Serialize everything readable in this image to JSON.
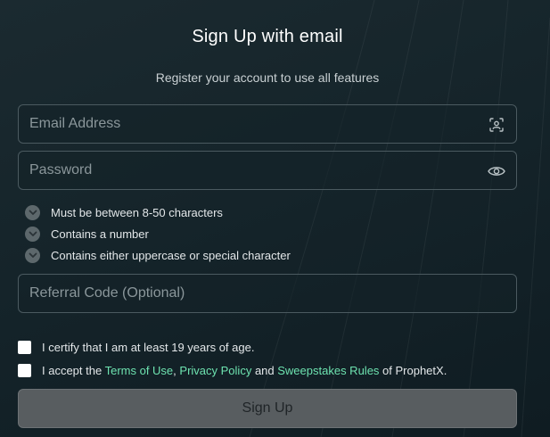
{
  "header": {
    "title": "Sign Up with email",
    "subtitle": "Register your account to use all features"
  },
  "form": {
    "email": {
      "placeholder": "Email Address",
      "value": "",
      "icon": "contact-card-icon"
    },
    "password": {
      "placeholder": "Password",
      "value": "",
      "icon": "eye-icon"
    },
    "referral": {
      "placeholder": "Referral Code (Optional)",
      "value": ""
    }
  },
  "password_rules": [
    {
      "label": "Must be between 8-50 characters"
    },
    {
      "label": "Contains a number"
    },
    {
      "label": "Contains either uppercase or special character"
    }
  ],
  "consents": {
    "age": {
      "label": "I certify that I am at least 19 years of age."
    },
    "terms": {
      "prefix": "I accept the ",
      "terms_link": "Terms of Use",
      "sep1": ", ",
      "privacy_link": "Privacy Policy",
      "sep2": " and ",
      "sweepstakes_link": "Sweepstakes Rules",
      "suffix": " of ProphetX."
    }
  },
  "submit": {
    "label": "Sign Up"
  },
  "colors": {
    "accent_link": "#6ee3b0",
    "button_bg": "#585d60",
    "background": "#15242a"
  }
}
